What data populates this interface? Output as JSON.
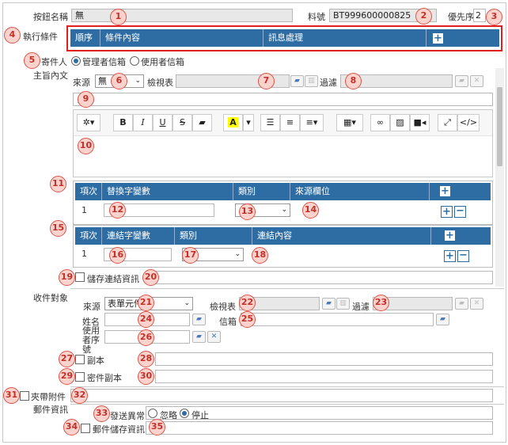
{
  "header": {
    "button_name_label": "按鈕名稱",
    "button_name_value": "無",
    "part_no_label": "料號",
    "part_no_value": "BT999600000825",
    "priority_label": "優先序",
    "priority_value": "2"
  },
  "conditions": {
    "label": "執行條件",
    "columns": [
      "順序",
      "條件內容",
      "訊息處理"
    ]
  },
  "sender": {
    "label": "寄件人",
    "options": [
      "管理者信箱",
      "使用者信箱"
    ],
    "selected": 0
  },
  "body": {
    "label": "主旨內文",
    "source_label": "來源",
    "source_value": "無",
    "view_label": "檢視表",
    "filter_label": "過濾",
    "subject_placeholder": "主旨"
  },
  "vars_table": {
    "columns": [
      "項次",
      "替換字變數",
      "類別",
      "來源欄位"
    ],
    "rows": [
      {
        "idx": "1"
      }
    ]
  },
  "link_table": {
    "columns": [
      "項次",
      "連結字變數",
      "類別",
      "連結內容"
    ],
    "rows": [
      {
        "idx": "1"
      }
    ]
  },
  "save_link": {
    "label": "儲存連結資訊"
  },
  "recipients": {
    "label": "收件對象",
    "source_label": "來源",
    "source_value": "表單元件",
    "view_label": "檢視表",
    "filter_label": "過濾",
    "name_label": "姓名",
    "mail_label": "信箱",
    "user_seq_label": "使用者序號",
    "cc_label": "副本",
    "bcc_label": "密件副本"
  },
  "attach": {
    "label": "夾帶附件"
  },
  "mail_info": {
    "label": "郵件資訊",
    "send_error_label": "發送異常",
    "options": [
      "忽略",
      "停止"
    ],
    "selected": 1,
    "save_label": "郵件儲存資訊"
  },
  "badges": [
    "1",
    "2",
    "3",
    "4",
    "5",
    "6",
    "7",
    "8",
    "9",
    "10",
    "11",
    "12",
    "13",
    "14",
    "15",
    "16",
    "17",
    "18",
    "19",
    "20",
    "21",
    "22",
    "23",
    "24",
    "25",
    "26",
    "27",
    "28",
    "29",
    "30",
    "31",
    "32",
    "33",
    "34",
    "35"
  ],
  "colors": {
    "header_blue": "#2e6da4",
    "highlight_red": "#e02020",
    "badge_fill": "#fbd3cc"
  }
}
